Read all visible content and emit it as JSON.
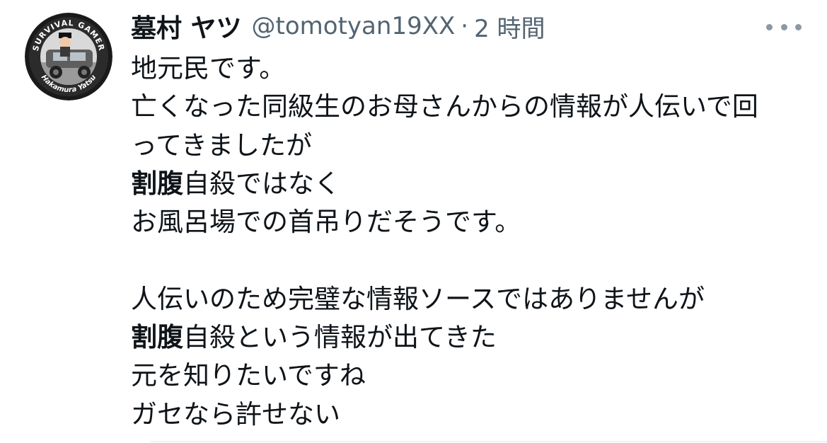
{
  "tweet": {
    "display_name": "墓村 ヤツ",
    "handle": "@tomotyan19XX",
    "separator": "·",
    "timestamp": "2 時間",
    "avatar": {
      "top_text": "SURVIVAL GAMER",
      "bottom_text": "Hakamura Yatsu"
    },
    "more_icon": "more-horizontal-icon",
    "lines": [
      {
        "plain": "地元民です。"
      },
      {
        "plain": "亡くなった同級生のお母さんからの情報が人伝いで回"
      },
      {
        "plain": "ってきましたが"
      },
      {
        "bold": "割腹",
        "rest": "自殺ではなく"
      },
      {
        "plain": "お風呂場での首吊りだそうです。"
      },
      {
        "plain": ""
      },
      {
        "plain": "人伝いのため完璧な情報ソースではありませんが"
      },
      {
        "bold": "割腹",
        "rest": "自殺という情報が出てきた"
      },
      {
        "plain": "元を知りたいですね"
      },
      {
        "plain": "ガセなら許せない"
      }
    ]
  },
  "colors": {
    "text": "#0f1419",
    "secondary": "#536471",
    "more_dots": "#8b98a5",
    "divider": "#eff3f4"
  }
}
